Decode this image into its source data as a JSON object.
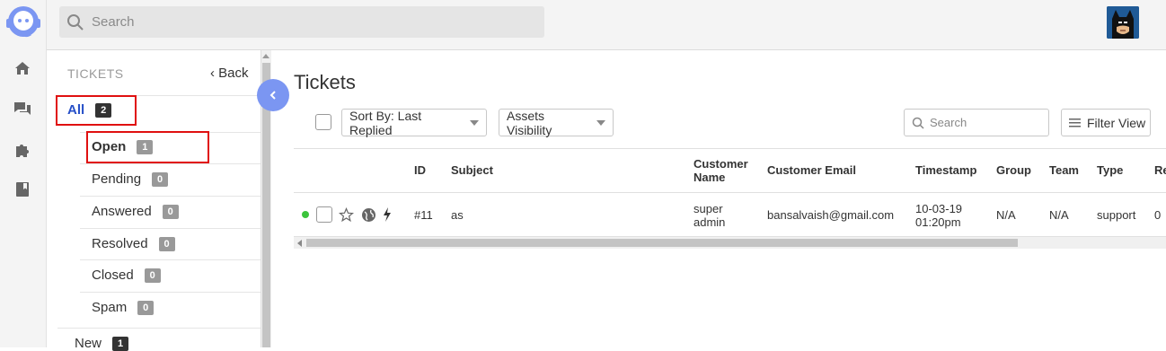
{
  "topbar": {
    "search_placeholder": "Search"
  },
  "rail": {
    "icons": [
      "logo-icon",
      "home-icon",
      "chat-icon",
      "puzzle-icon",
      "book-icon"
    ]
  },
  "panel": {
    "heading": "TICKETS",
    "back_label": "Back",
    "all_label": "All",
    "all_count": "2",
    "statuses": [
      {
        "label": "Open",
        "count": "1"
      },
      {
        "label": "Pending",
        "count": "0"
      },
      {
        "label": "Answered",
        "count": "0"
      },
      {
        "label": "Resolved",
        "count": "0"
      },
      {
        "label": "Closed",
        "count": "0"
      },
      {
        "label": "Spam",
        "count": "0"
      }
    ],
    "new_label": "New",
    "new_count": "1"
  },
  "main": {
    "title": "Tickets",
    "sort_label": "Sort By: Last Replied",
    "assets_label": "Assets Visibility",
    "search_placeholder": "Search",
    "filter_label": "Filter View"
  },
  "table": {
    "headers": {
      "id": "ID",
      "subject": "Subject",
      "customer_name_1": "Customer",
      "customer_name_2": "Name",
      "customer_email": "Customer Email",
      "timestamp": "Timestamp",
      "group": "Group",
      "team": "Team",
      "type": "Type",
      "replies": "Re"
    },
    "rows": [
      {
        "id": "#11",
        "subject": "as",
        "customer_name_1": "super",
        "customer_name_2": "admin",
        "customer_email": "bansalvaish@gmail.com",
        "timestamp_1": "10-03-19",
        "timestamp_2": "01:20pm",
        "group": "N/A",
        "team": "N/A",
        "type": "support",
        "replies": "0"
      }
    ]
  },
  "colors": {
    "accent": "#2750c8",
    "highlight": "#e01010",
    "online": "#3cc43c",
    "collapse": "#7b96f2"
  }
}
